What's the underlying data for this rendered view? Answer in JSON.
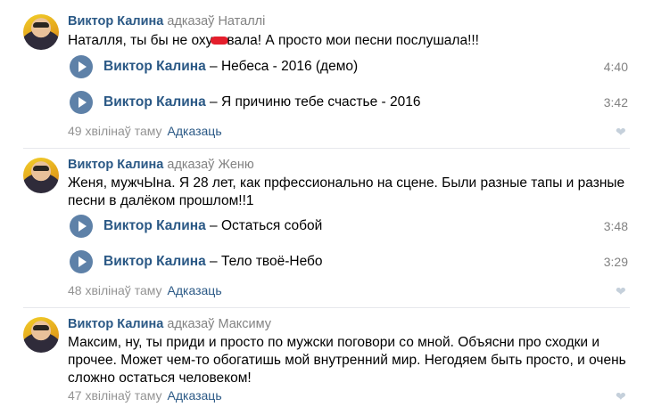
{
  "comments": [
    {
      "author": "Виктор Калина",
      "replied_to": "адказаў Наталлі",
      "text_before": "Наталля, ты бы не оху",
      "text_after": "вала! А просто мои песни послушала!!!",
      "tracks": [
        {
          "artist": "Виктор Калина",
          "sep": " – ",
          "title": "Небеса - 2016 (демо)",
          "duration": "4:40"
        },
        {
          "artist": "Виктор Калина",
          "sep": " – ",
          "title": "Я причиню тебе счастье - 2016",
          "duration": "3:42"
        }
      ],
      "time": "49 хвілінаў таму",
      "reply_label": "Адказаць"
    },
    {
      "author": "Виктор Калина",
      "replied_to": "адказаў Жeню",
      "text": "Женя, мужчЫна. Я 28 лет, как прфессионально на сцене. Были разные тапы и разные песни в далёком прошлом!!1",
      "tracks": [
        {
          "artist": "Виктор Калина",
          "sep": " – ",
          "title": "Остаться собой",
          "duration": "3:48"
        },
        {
          "artist": "Виктор Калина",
          "sep": " – ",
          "title": "Тело твоё-Небо",
          "duration": "3:29"
        }
      ],
      "time": "48 хвілінаў таму",
      "reply_label": "Адказаць"
    },
    {
      "author": "Виктор Калина",
      "replied_to": "адказаў Максиму",
      "text": "Максим, ну, ты приди и просто по мужски поговори со мной. Объясни про сходки и прочее. Может чем-то обогатишь мой внутренний мир. Негодяем быть просто, и очень сложно остаться человеком!",
      "time": "47 хвілінаў таму",
      "reply_label": "Адказаць"
    }
  ],
  "icons": {
    "play": "play-icon",
    "like": "heart-icon"
  },
  "colors": {
    "link": "#2a5885",
    "muted": "#828282",
    "play_button": "#5e81a8",
    "like": "#c5d0db",
    "redaction": "#e41e2c"
  }
}
